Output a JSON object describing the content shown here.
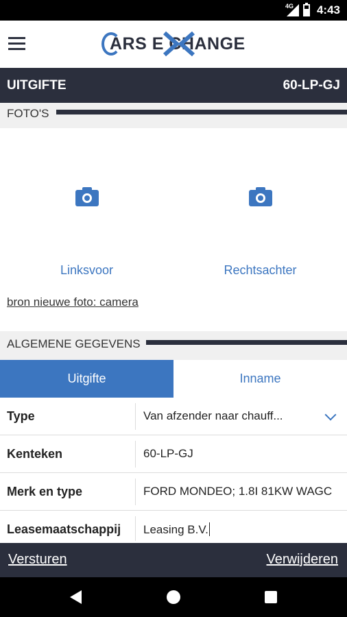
{
  "status": {
    "network": "4G",
    "time": "4:43"
  },
  "header": {
    "logo_text": "ARS E  CHANGE",
    "menu_icon": "hamburger-menu-icon"
  },
  "title_bar": {
    "title": "UITGIFTE",
    "plate": "60-LP-GJ"
  },
  "photos": {
    "section_title": "FOTO'S",
    "slots": [
      {
        "label": "Linksvoor",
        "icon": "camera-icon"
      },
      {
        "label": "Rechtsachter",
        "icon": "camera-icon"
      }
    ],
    "source_link": "bron nieuwe foto: camera"
  },
  "general": {
    "section_title": "ALGEMENE GEGEVENS",
    "tabs": [
      {
        "label": "Uitgifte",
        "active": true
      },
      {
        "label": "Inname",
        "active": false
      }
    ],
    "fields": [
      {
        "key": "Type",
        "value": "Van afzender naar chauff..."
      },
      {
        "key": "Kenteken",
        "value": "60-LP-GJ"
      },
      {
        "key": "Merk en type",
        "value": "FORD MONDEO; 1.8I 81KW WAGC"
      },
      {
        "key": "Leasemaatschappij",
        "value": "Leasing B.V."
      }
    ]
  },
  "actions": {
    "send": "Versturen",
    "delete": "Verwijderen"
  },
  "colors": {
    "brand_dark": "#2b2f3d",
    "accent_blue": "#3c76c0"
  }
}
